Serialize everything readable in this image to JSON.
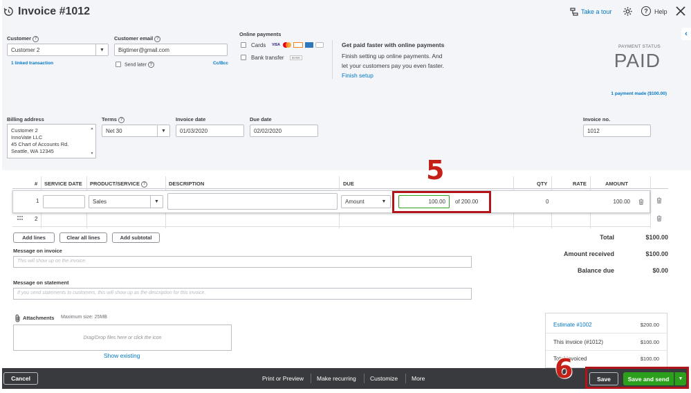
{
  "header": {
    "title": "Invoice #1012",
    "take_tour": "Take a tour",
    "help": "Help"
  },
  "customer": {
    "label": "Customer",
    "value": "Customer 2",
    "linked": "1 linked transaction"
  },
  "email": {
    "label": "Customer email",
    "value": "Bigtimer@gmail.com",
    "send_later": "Send later",
    "cc_bcc": "Cc/Bcc"
  },
  "online_payments": {
    "label": "Online payments",
    "cards": "Cards",
    "bank_transfer": "Bank transfer",
    "bank_badge": "BANK",
    "card_badges": [
      "VISA",
      "MC",
      "DISC",
      "AMEX",
      "PAY"
    ],
    "promo_title": "Get paid faster with online payments",
    "promo_text_1": "Finish setting up online payments. And",
    "promo_text_2": "let your customers pay you even faster.",
    "finish_setup": "Finish setup"
  },
  "payment_status": {
    "label": "PAYMENT STATUS",
    "value": "PAID",
    "payment_made": "1 payment made ($100.00)"
  },
  "billing": {
    "label": "Billing address",
    "lines": [
      "Customer 2",
      "InnoVate LLC",
      "45 Chart of Accounts Rd.",
      "Seattle, WA  12345"
    ]
  },
  "terms": {
    "label": "Terms",
    "value": "Net 30"
  },
  "invoice_date": {
    "label": "Invoice date",
    "value": "01/03/2020"
  },
  "due_date": {
    "label": "Due date",
    "value": "02/02/2020"
  },
  "invoice_no": {
    "label": "Invoice no.",
    "value": "1012"
  },
  "table": {
    "headers": {
      "num": "#",
      "service_date": "SERVICE DATE",
      "product": "PRODUCT/SERVICE",
      "description": "DESCRIPTION",
      "due": "DUE",
      "qty": "QTY",
      "rate": "RATE",
      "amount": "AMOUNT"
    },
    "rows": [
      {
        "num": "1",
        "product": "Sales",
        "due_type": "Amount",
        "due_value": "100.00",
        "due_of": "of 200.00",
        "qty": "0",
        "amount": "100.00"
      },
      {
        "num": "2"
      }
    ]
  },
  "actions": {
    "add_lines": "Add lines",
    "clear_lines": "Clear all lines",
    "add_subtotal": "Add subtotal"
  },
  "messages": {
    "invoice_label": "Message on invoice",
    "invoice_placeholder": "This will show up on the invoice.",
    "statement_label": "Message on statement",
    "statement_placeholder": "If you send statements to customers, this will show up as the description for this invoice."
  },
  "attachments": {
    "label": "Attachments",
    "max_size": "Maximum size: 25MB",
    "drop_text": "Drag/Drop files here or click the icon",
    "show_existing": "Show existing"
  },
  "totals": {
    "total_label": "Total",
    "total_value": "$100.00",
    "received_label": "Amount received",
    "received_value": "$100.00",
    "balance_label": "Balance due",
    "balance_value": "$0.00"
  },
  "linked_panel": {
    "estimate_label": "Estimate #1002",
    "estimate_value": "$200.00",
    "this_invoice_label": "This invoice (#1012)",
    "this_invoice_value": "$100.00",
    "total_invoiced_label": "Total invoiced",
    "total_invoiced_value": "$100.00"
  },
  "footer": {
    "cancel": "Cancel",
    "print_preview": "Print or Preview",
    "make_recurring": "Make recurring",
    "customize": "Customize",
    "more": "More",
    "save": "Save",
    "save_and_send": "Save and send"
  },
  "annotations": {
    "step5": "5",
    "step6": "6"
  },
  "colors": {
    "accent": "#0077c5",
    "green": "#2ca01c",
    "highlight": "#b2141a",
    "footer": "#393a3d"
  }
}
